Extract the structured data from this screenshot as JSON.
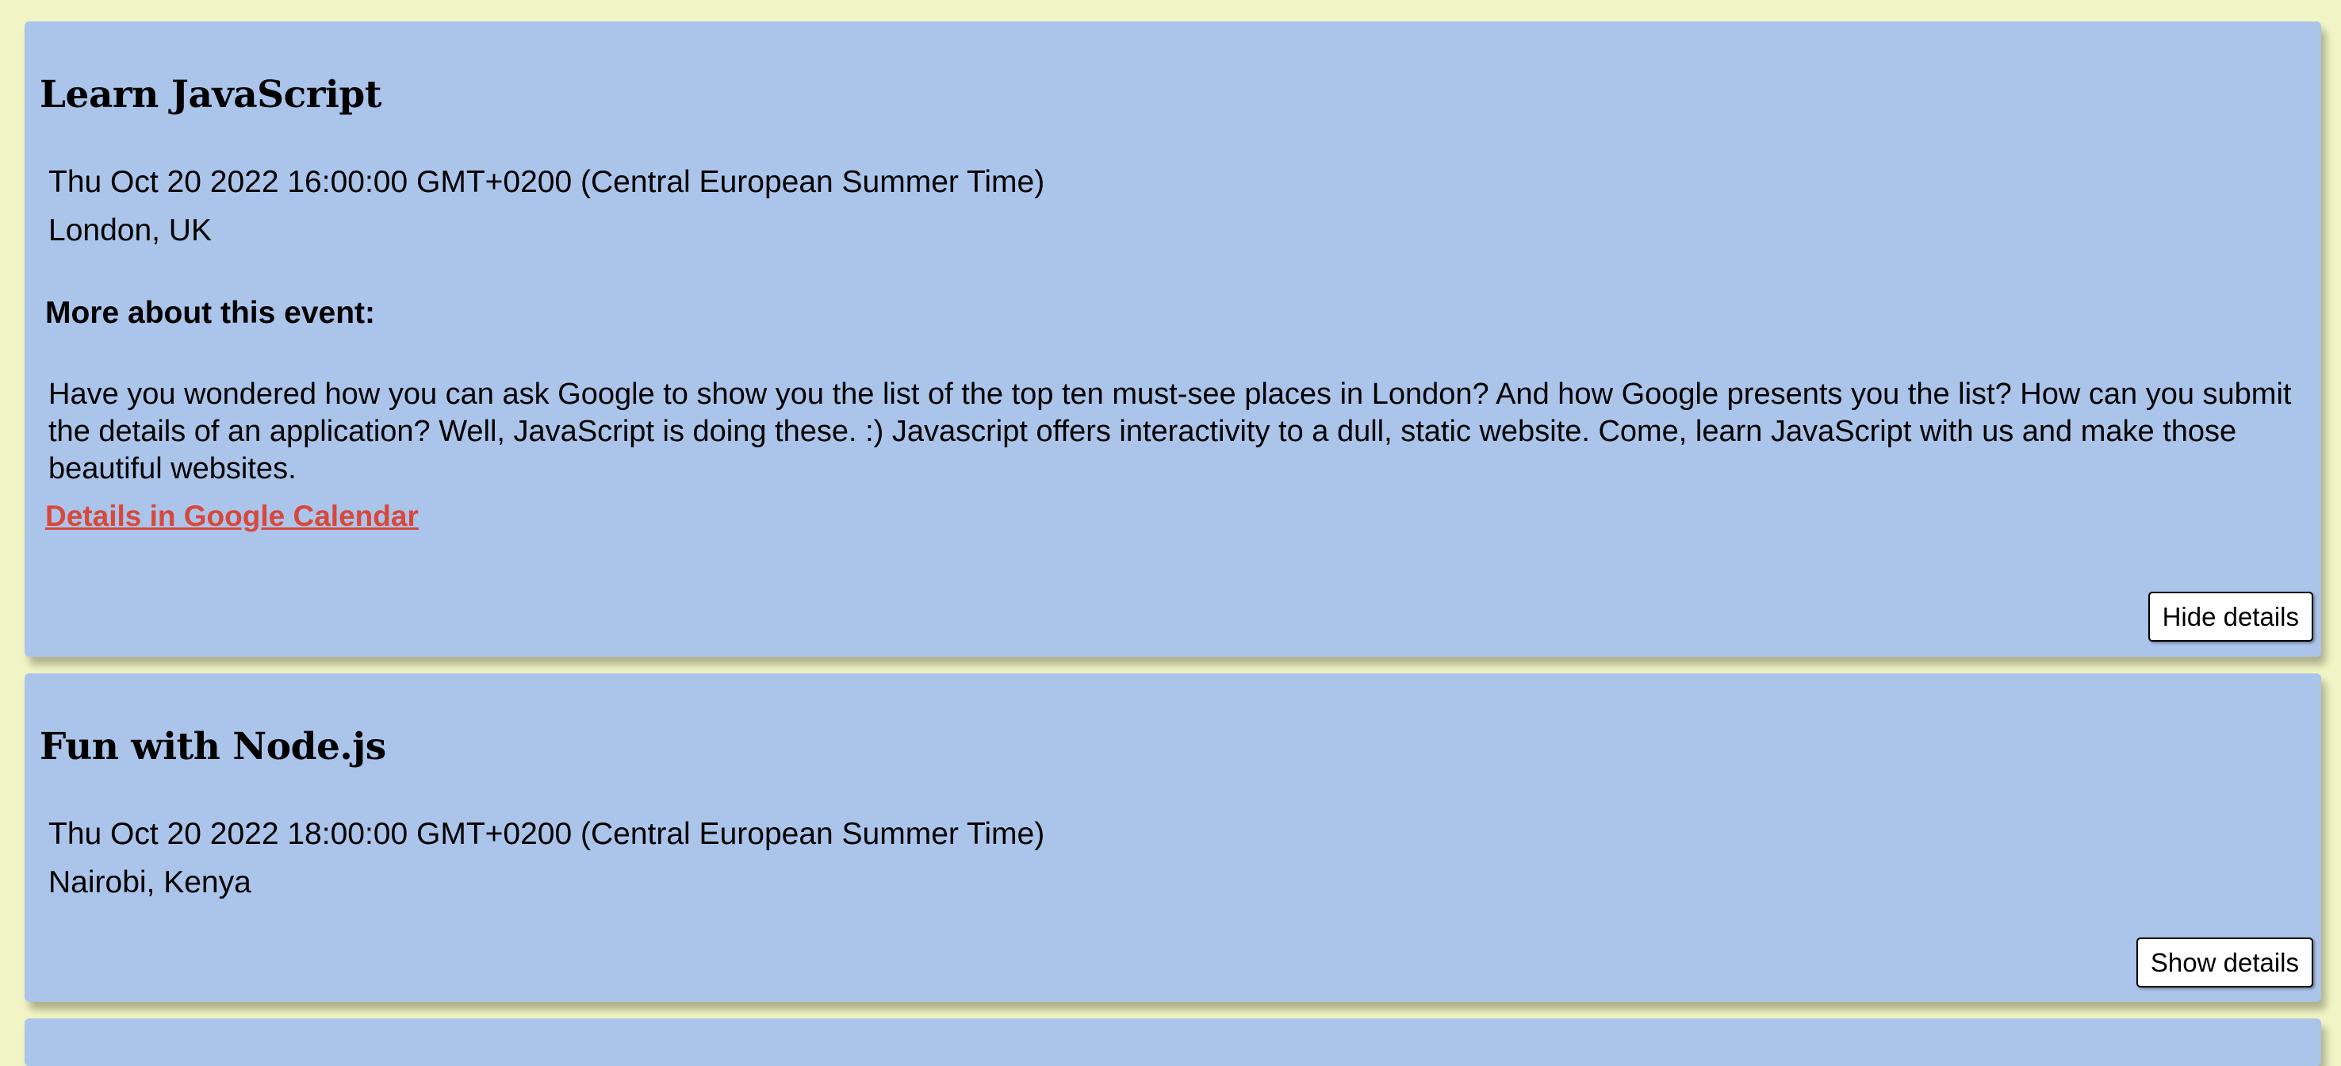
{
  "events": [
    {
      "title": "Learn JavaScript",
      "date": "Thu Oct 20 2022 16:00:00 GMT+0200 (Central European Summer Time)",
      "location": "London, UK",
      "about_heading": "More about this event:",
      "description": "Have you wondered how you can ask Google to show you the list of the top ten must-see places in London? And how Google presents you the list? How can you submit the details of an application? Well, JavaScript is doing these. :) Javascript offers interactivity to a dull, static website. Come, learn JavaScript with us and make those beautiful websites.",
      "calendar_link": "Details in Google Calendar",
      "toggle_label": "Hide details"
    },
    {
      "title": "Fun with Node.js",
      "date": "Thu Oct 20 2022 18:00:00 GMT+0200 (Central European Summer Time)",
      "location": "Nairobi, Kenya",
      "toggle_label": "Show details"
    }
  ],
  "colors": {
    "page_background": "#f1f4c4",
    "card_background": "#abc4ea",
    "link": "#d8483b"
  }
}
